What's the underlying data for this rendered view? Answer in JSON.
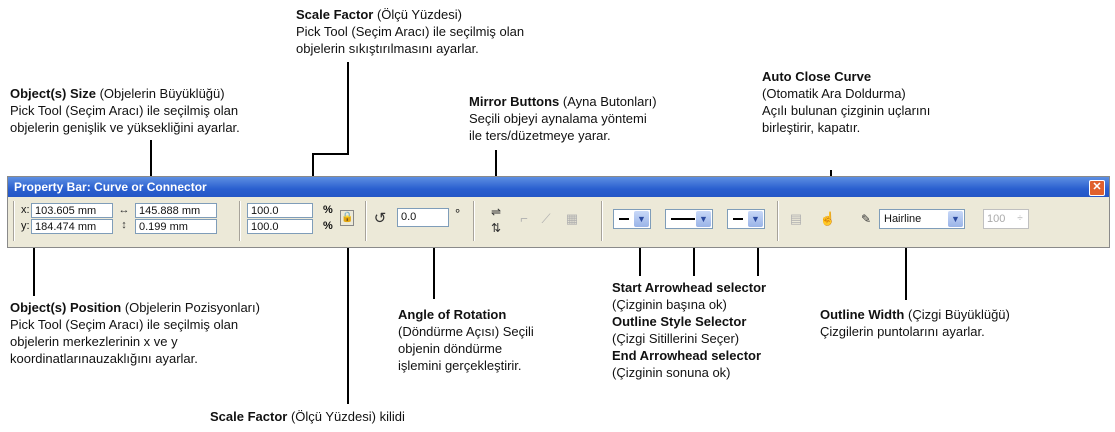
{
  "annotations": {
    "scale_factor_top": {
      "bold": "Scale Factor",
      "paren": " (Ölçü Yüzdesi)",
      "lines": [
        "Pick Tool (Seçim Aracı) ile seçilmiş olan",
        "objelerin sıkıştırılmasını ayarlar."
      ]
    },
    "object_size": {
      "bold": "Object(s) Size",
      "paren": " (Objelerin Büyüklüğü)",
      "lines": [
        "Pick Tool (Seçim Aracı) ile seçilmiş olan",
        "objelerin genişlik ve yüksekliğini ayarlar."
      ]
    },
    "mirror_buttons": {
      "bold": "Mirror Buttons",
      "paren": " (Ayna Butonları)",
      "lines": [
        "Seçili objeyi aynalama yöntemi",
        "ile ters/düzetmeye yarar."
      ]
    },
    "auto_close": {
      "bold": "Auto Close Curve",
      "lines": [
        "(Otomatik Ara Doldurma)",
        "Açılı bulunan çizginin uçlarını",
        "birleştirir, kapatır."
      ]
    },
    "object_position": {
      "bold": "Object(s) Position",
      "paren": " (Objelerin Pozisyonları)",
      "lines": [
        "Pick Tool (Seçim Aracı) ile seçilmiş olan",
        "objelerin merkezlerinin x ve y",
        "koordinatlarınauzaklığını ayarlar."
      ]
    },
    "angle_rotation": {
      "bold": "Angle of Rotation",
      "lines": [
        "(Döndürme Açısı) Seçili",
        "objenin döndürme",
        "işlemini gerçekleştirir."
      ]
    },
    "arrowheads": {
      "start_bold": "Start Arrowhead selector",
      "start_desc": "(Çizginin başına ok)",
      "style_bold": "Outline Style Selector",
      "style_desc": "(Çizgi Sitillerini Seçer)",
      "end_bold": "End Arrowhead selector",
      "end_desc": "(Çizginin sonuna ok)"
    },
    "outline_width": {
      "bold": "Outline Width",
      "paren": " (Çizgi Büyüklüğü)",
      "lines": [
        "Çizgilerin puntolarını ayarlar."
      ]
    },
    "scale_lock": {
      "bold": "Scale Factor",
      "paren": " (Ölçü Yüzdesi) kilidi"
    }
  },
  "property_bar": {
    "title": "Property Bar: Curve or Connector",
    "x_label": "x:",
    "y_label": "y:",
    "x_value": "103.605 mm",
    "y_value": "184.474 mm",
    "width_value": "145.888 mm",
    "height_value": "0.199 mm",
    "scale_x": "100.0",
    "scale_y": "100.0",
    "percent": "%",
    "angle_value": "0.0",
    "degree": "°",
    "outline_width": "Hairline",
    "disabled_value": "100"
  }
}
